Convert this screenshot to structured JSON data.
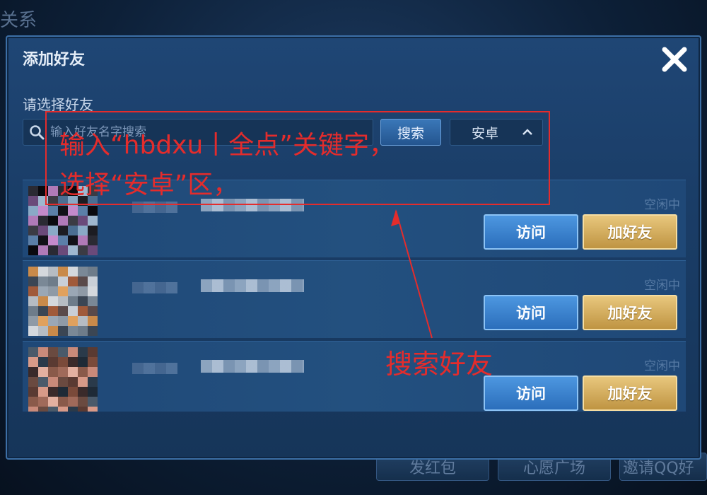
{
  "background": {
    "title": "关系",
    "bottom_buttons": [
      "发红包",
      "心愿广场",
      "邀请QQ好"
    ]
  },
  "dialog": {
    "title": "添加好友",
    "close_icon": "close-icon",
    "choose_label": "请选择好友",
    "search": {
      "placeholder": "输入好友名字搜索",
      "button_label": "搜索",
      "region_value": "安卓"
    },
    "friends": [
      {
        "status": "空闲中",
        "visit_label": "访问",
        "add_label": "加好友"
      },
      {
        "status": "空闲中",
        "visit_label": "访问",
        "add_label": "加好友"
      },
      {
        "status": "空闲中",
        "visit_label": "访问",
        "add_label": "加好友"
      }
    ]
  },
  "annotation": {
    "line1": "输入“hbdxu丨全点”关键字，",
    "line2": "选择“安卓”区，",
    "arrow_label": "搜索好友",
    "color": "#e42c2c"
  },
  "colors": {
    "visit_button": "#2b6ebb",
    "add_button": "#bf9442",
    "dialog_bg": "#1a3d67"
  }
}
